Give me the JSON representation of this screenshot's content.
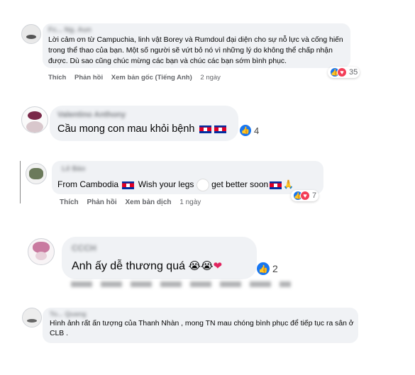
{
  "comments": [
    {
      "name": "Fc... Ng. Aun",
      "text": "Lời cảm ơn từ Campuchia, linh vật Borey và Rumdoul đại diện cho sự nỗ lực và cống hiến trong thể thao của bạn. Một số người sẽ vứt bỏ nó vì những lý do không thể chấp nhận được. Dù sao cũng chúc mừng các bạn và chúc các bạn sớm bình phục.",
      "actions": {
        "like": "Thích",
        "reply": "Phản hồi",
        "translate": "Xem bản gốc (Tiếng Anh)",
        "time": "2 ngày"
      },
      "reactions": {
        "count": "35"
      }
    },
    {
      "name": "Valentino Anthony",
      "text": "Cầu mong con mau khỏi bệnh",
      "reactions": {
        "count": "4"
      }
    },
    {
      "name": "Lê Bảo",
      "text_a": "From Cambodia",
      "text_b": "Wish your legs",
      "text_c": "get better soon",
      "actions": {
        "like": "Thích",
        "reply": "Phản hồi",
        "translate": "Xem bản dịch",
        "time": "1 ngày"
      },
      "reactions": {
        "count": "7"
      }
    },
    {
      "name": "CCCH",
      "text": "Anh ấy dễ thương quá",
      "reactions": {
        "count": "2"
      }
    },
    {
      "name": "To... Quang",
      "text": "Hình ảnh rất ấn tượng của Thanh Nhàn , mong TN mau chóng bình phục để tiếp tục ra sân ở CLB ."
    }
  ]
}
